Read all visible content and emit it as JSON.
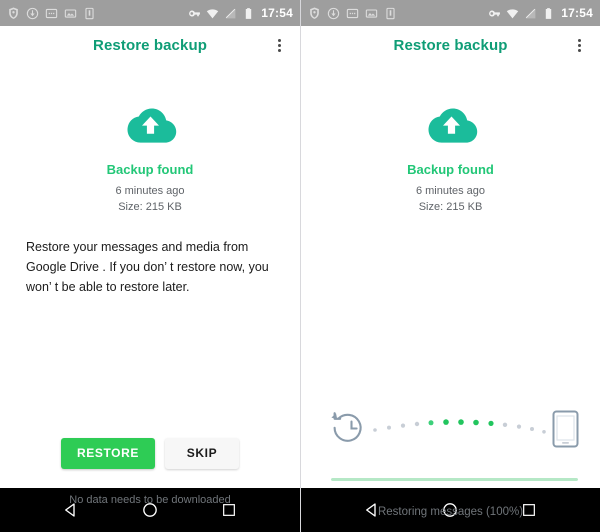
{
  "statusbar": {
    "left_icons": [
      "shield-notification-icon",
      "download-notification-icon",
      "sms-notification-icon",
      "image-notification-icon",
      "sim-notification-icon"
    ],
    "right_icons": [
      "vpn-key-icon",
      "wifi-icon",
      "signal-off-icon",
      "battery-icon"
    ],
    "time": "17:54"
  },
  "appbar": {
    "title": "Restore backup",
    "overflow_icon": "more-vert-icon"
  },
  "backup": {
    "cloud_icon": "cloud-upload-icon",
    "status": "Backup found",
    "time_ago": "6 minutes ago",
    "size": "Size: 215 KB",
    "description": "Restore your messages and media from Google Drive . If you don’ t restore now, you won’ t be able to restore later."
  },
  "actions": {
    "restore_label": "RESTORE",
    "skip_label": "SKIP",
    "footnote": "No data needs to be downloaded"
  },
  "progress": {
    "source_icon": "restore-history-icon",
    "target_icon": "smartphone-icon",
    "dots_total": 14,
    "dots_active": 5,
    "percent": 100,
    "label": "Restoring messages (100%)"
  },
  "navbar": {
    "back_label": "back-icon",
    "home_label": "home-icon",
    "recents_label": "recents-icon"
  },
  "colors": {
    "brand_teal": "#0f9d76",
    "accent_green": "#22c777",
    "button_green": "#2ecc55",
    "progress_fill": "#b5e8c6",
    "statusbar_gray": "#9e9e9e"
  }
}
